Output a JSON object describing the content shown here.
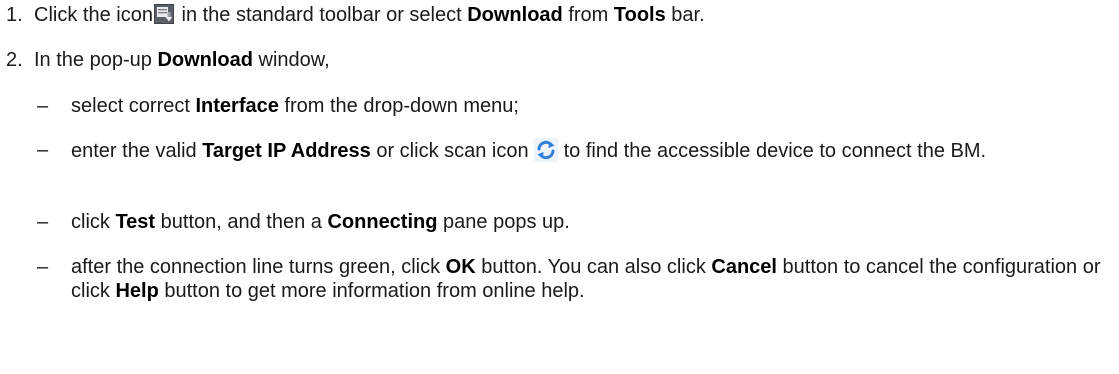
{
  "steps": [
    {
      "number": "1.",
      "t1": "Click the icon",
      "icon": "download-tool-icon",
      "t2": " in the standard toolbar or select ",
      "b1": "Download",
      "t3": " from ",
      "b2": "Tools",
      "t4": " bar."
    },
    {
      "number": "2.",
      "t1": "In the pop-up ",
      "b1": "Download",
      "t2": " window,"
    }
  ],
  "substeps": [
    {
      "dash": "–",
      "t1": "select correct ",
      "b1": "Interface",
      "t2": " from the drop-down menu;"
    },
    {
      "dash": "–",
      "t1": "enter the valid ",
      "b1": "Target IP Address",
      "t2": " or click scan icon",
      "icon": "refresh-scan-icon",
      "t3": "to find the accessible device to connect the BM."
    },
    {
      "dash": "–",
      "t1": "click ",
      "b1": "Test",
      "t2": " button, and then a ",
      "b2": "Connecting",
      "t3": " pane pops up."
    },
    {
      "dash": "–",
      "t1": "after the connection line turns green, click ",
      "b1": "OK",
      "t2": " button. You can also click ",
      "b2": "Cancel",
      "t3": " button to cancel the configuration or click ",
      "b3": "Help",
      "t4": " button to get more information from online help."
    }
  ],
  "colors": {
    "text": "#1a1a1a",
    "scan_icon_blue": "#2f7fd8"
  }
}
